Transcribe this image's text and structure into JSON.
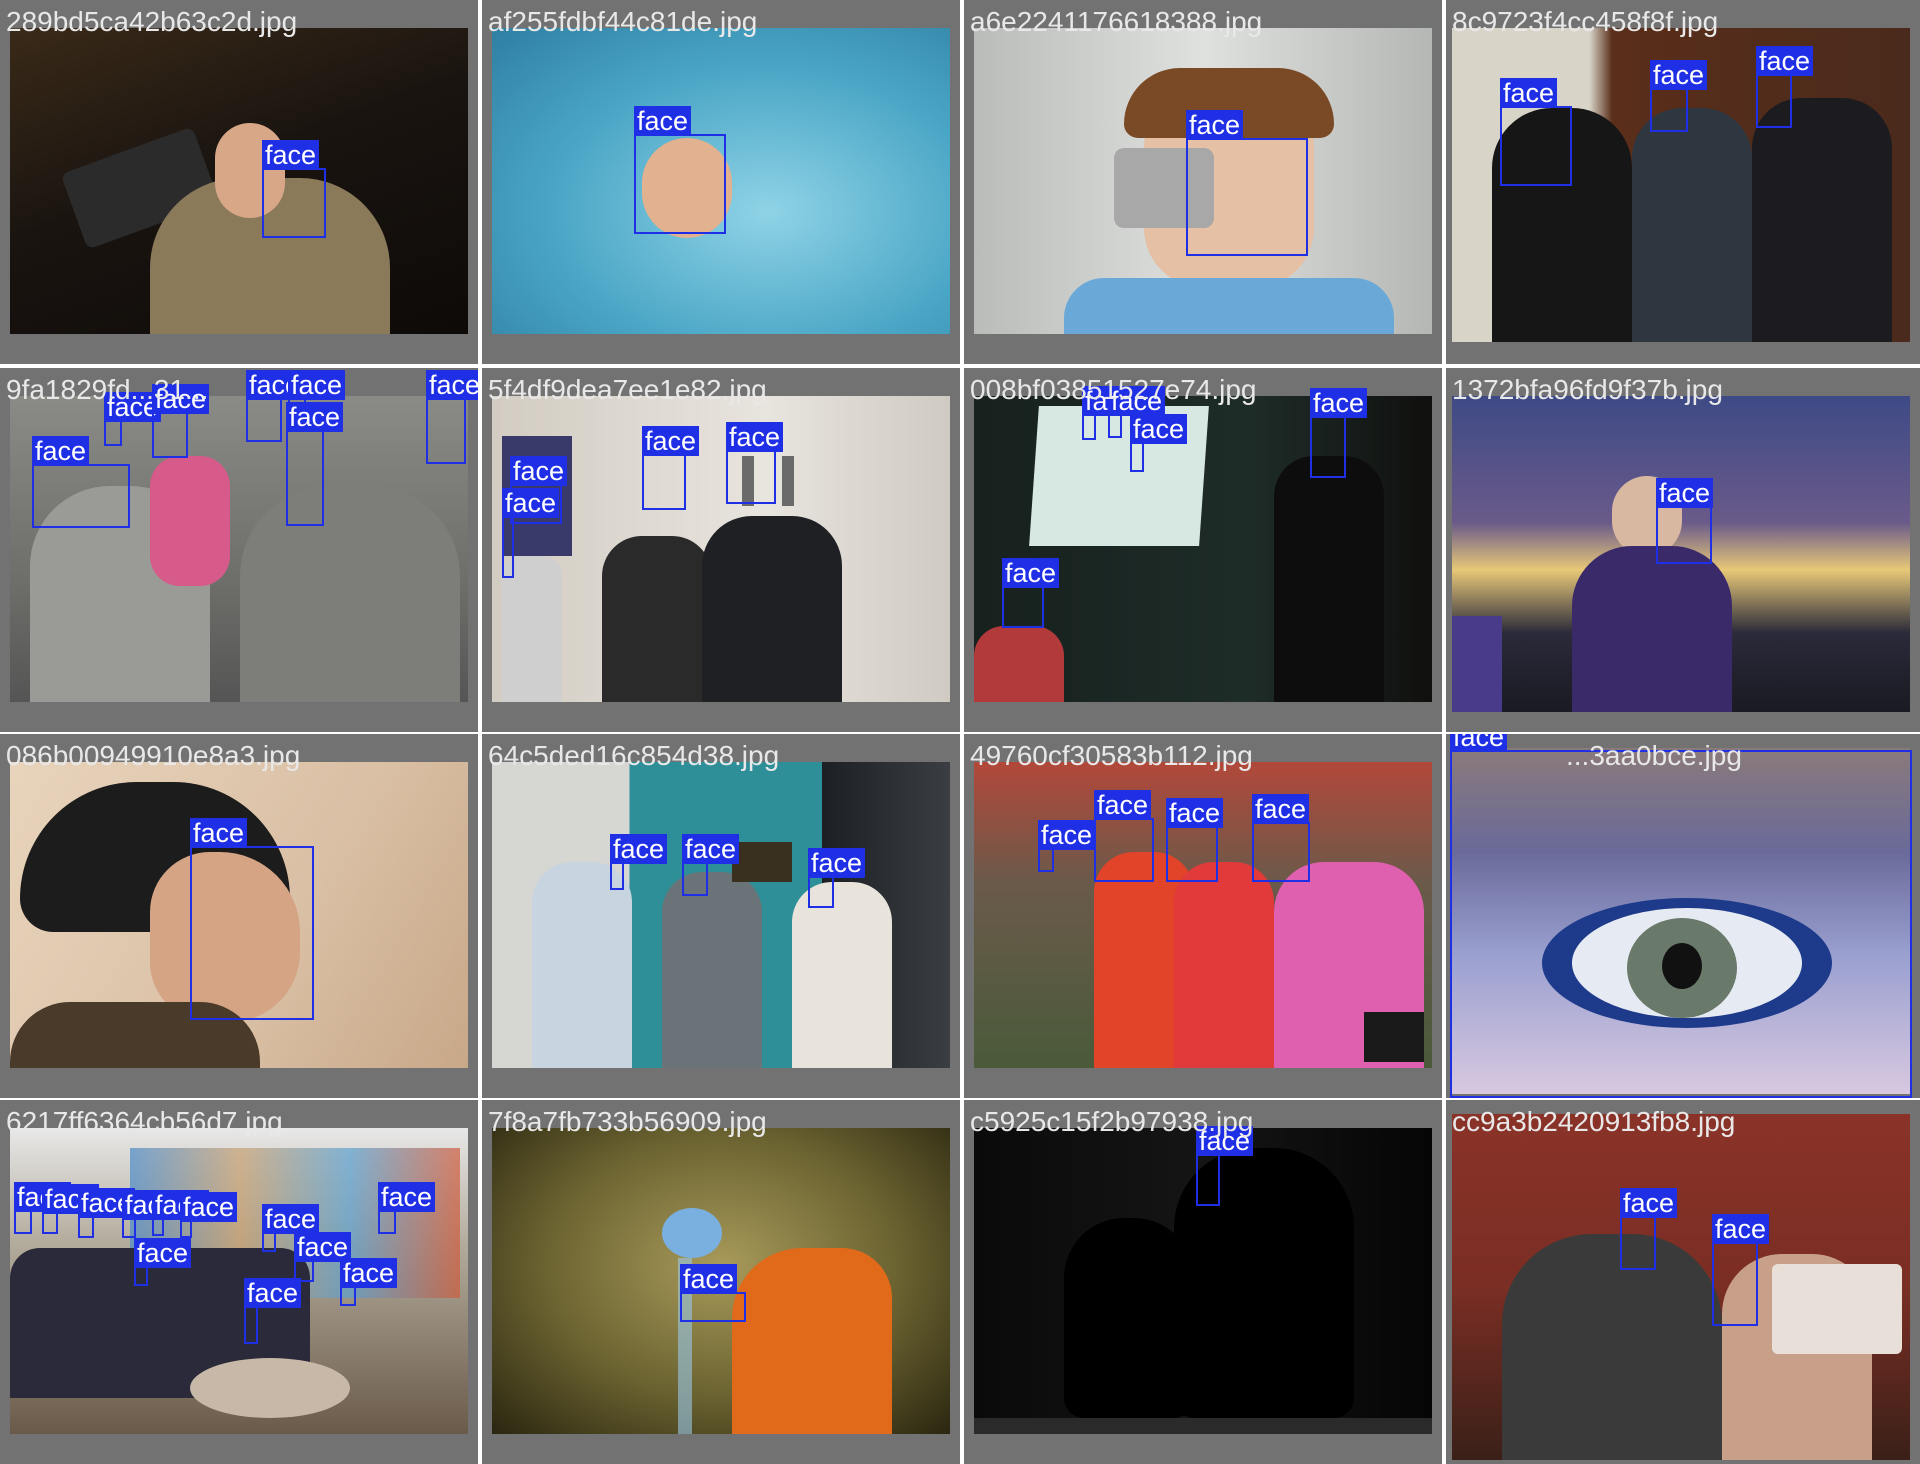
{
  "box_color": "#1f2fe6",
  "tiles": [
    {
      "filename": "289bd5ca42b63c2d.jpg",
      "label": "face",
      "background": "#1a1410",
      "faces": 1
    },
    {
      "filename": "af255fdbf44c81de.jpg",
      "label": "face",
      "background": "#5fb6cf",
      "faces": 1
    },
    {
      "filename": "a6e2241176618388.jpg",
      "label": "face",
      "background": "#c9ccc9",
      "faces": 1
    },
    {
      "filename": "8c9723f4cc458f8f.jpg",
      "label": "face",
      "background": "#4a2a1c",
      "faces": 3
    },
    {
      "filename": "9fa1829fd...31...",
      "label": "face",
      "background": "#6e6e6a",
      "faces": 7
    },
    {
      "filename": "5f4df9dea7ee1e82.jpg",
      "label": "face",
      "background": "#d9d4cc",
      "faces": 4
    },
    {
      "filename": "008bf03851527e74.jpg",
      "label": "face",
      "background": "#1c2a26",
      "faces": 5
    },
    {
      "filename": "1372bfa96fd9f37b.jpg",
      "label": "face",
      "background": "#3b3a66",
      "faces": 1
    },
    {
      "filename": "086b00949910e8a3.jpg",
      "label": "face",
      "background": "#d9bfa4",
      "faces": 1
    },
    {
      "filename": "64c5ded16c854d38.jpg",
      "label": "face",
      "background": "#2e8f98",
      "faces": 3
    },
    {
      "filename": "49760cf30583b112.jpg",
      "label": "face",
      "background": "#6a5a4a",
      "faces": 4
    },
    {
      "filename": "...3aa0bce.jpg",
      "label": "face",
      "background": "#7a7fb8",
      "faces": 1
    },
    {
      "filename": "6217ff6364cb56d7.jpg",
      "label": "face",
      "background": "#a89a8a",
      "faces": 12
    },
    {
      "filename": "7f8a7fb733b56909.jpg",
      "label": "face",
      "background": "#6a6230",
      "faces": 1
    },
    {
      "filename": "c5925c15f2b97938.jpg",
      "label": "face",
      "background": "#050505",
      "faces": 1
    },
    {
      "filename": "cc9a3b2420913fb8.jpg",
      "label": "face",
      "background": "#7a2e24",
      "faces": 2
    }
  ]
}
